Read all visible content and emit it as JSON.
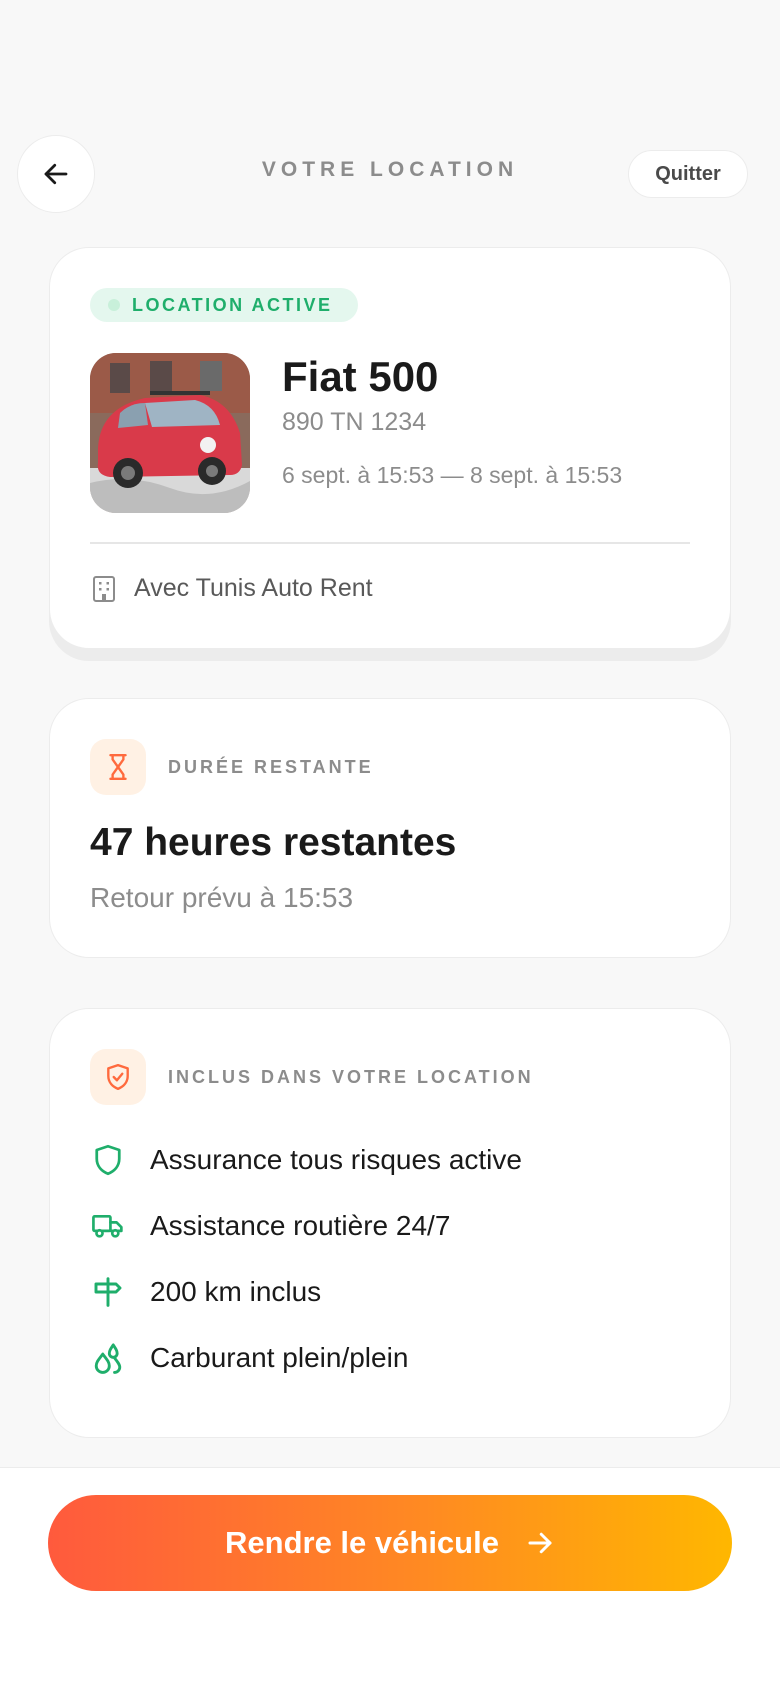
{
  "header": {
    "title": "VOTRE LOCATION",
    "quit_label": "Quitter"
  },
  "rental": {
    "status_badge": "LOCATION ACTIVE",
    "car_name": "Fiat 500",
    "plate": "890 TN 1234",
    "dates": "6 sept. à 15:53 — 8 sept. à 15:53",
    "company": "Avec Tunis Auto Rent"
  },
  "duration": {
    "label": "DURÉE RESTANTE",
    "remaining": "47 heures restantes",
    "return_time": "Retour prévu à 15:53"
  },
  "included": {
    "label": "INCLUS DANS VOTRE LOCATION",
    "items": [
      {
        "icon": "shield-icon",
        "text": "Assurance tous risques active"
      },
      {
        "icon": "truck-icon",
        "text": "Assistance routière 24/7"
      },
      {
        "icon": "signpost-icon",
        "text": "200 km inclus"
      },
      {
        "icon": "fuel-drops-icon",
        "text": "Carburant plein/plein"
      }
    ]
  },
  "action": {
    "return_label": "Rendre le véhicule"
  },
  "colors": {
    "accent_green": "#1fae6b",
    "accent_orange": "#ff6a3d",
    "gradient_end": "#ffb700",
    "muted_text": "#8c8c8c"
  }
}
